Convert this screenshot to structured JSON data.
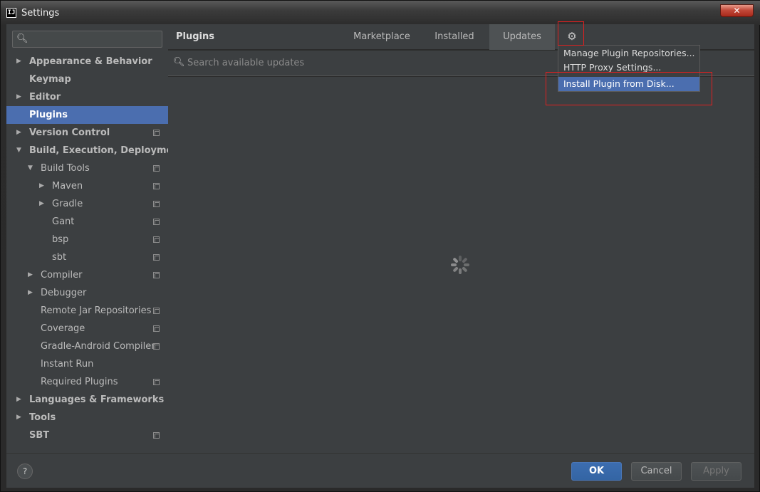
{
  "window": {
    "title": "Settings",
    "app_icon_text": "IJ",
    "close_glyph": "✕"
  },
  "sidebar": {
    "search_icon": "search-icon",
    "items": [
      {
        "label": "Appearance & Behavior",
        "level": 0,
        "arrow": "▶",
        "bold": true,
        "proj": false
      },
      {
        "label": "Keymap",
        "level": 0,
        "arrow": "",
        "bold": true,
        "proj": false
      },
      {
        "label": "Editor",
        "level": 0,
        "arrow": "▶",
        "bold": true,
        "proj": false
      },
      {
        "label": "Plugins",
        "level": 0,
        "arrow": "",
        "bold": true,
        "proj": false,
        "selected": true
      },
      {
        "label": "Version Control",
        "level": 0,
        "arrow": "▶",
        "bold": true,
        "proj": true
      },
      {
        "label": "Build, Execution, Deployment",
        "level": 0,
        "arrow": "▼",
        "bold": true,
        "proj": false
      },
      {
        "label": "Build Tools",
        "level": 1,
        "arrow": "▼",
        "bold": false,
        "proj": true
      },
      {
        "label": "Maven",
        "level": 2,
        "arrow": "▶",
        "bold": false,
        "proj": true
      },
      {
        "label": "Gradle",
        "level": 2,
        "arrow": "▶",
        "bold": false,
        "proj": true
      },
      {
        "label": "Gant",
        "level": 2,
        "arrow": "",
        "bold": false,
        "proj": true
      },
      {
        "label": "bsp",
        "level": 2,
        "arrow": "",
        "bold": false,
        "proj": true
      },
      {
        "label": "sbt",
        "level": 2,
        "arrow": "",
        "bold": false,
        "proj": true
      },
      {
        "label": "Compiler",
        "level": 1,
        "arrow": "▶",
        "bold": false,
        "proj": true
      },
      {
        "label": "Debugger",
        "level": 1,
        "arrow": "▶",
        "bold": false,
        "proj": false
      },
      {
        "label": "Remote Jar Repositories",
        "level": 1,
        "arrow": "",
        "bold": false,
        "proj": true
      },
      {
        "label": "Coverage",
        "level": 1,
        "arrow": "",
        "bold": false,
        "proj": true
      },
      {
        "label": "Gradle-Android Compiler",
        "level": 1,
        "arrow": "",
        "bold": false,
        "proj": true
      },
      {
        "label": "Instant Run",
        "level": 1,
        "arrow": "",
        "bold": false,
        "proj": false
      },
      {
        "label": "Required Plugins",
        "level": 1,
        "arrow": "",
        "bold": false,
        "proj": true
      },
      {
        "label": "Languages & Frameworks",
        "level": 0,
        "arrow": "▶",
        "bold": true,
        "proj": false
      },
      {
        "label": "Tools",
        "level": 0,
        "arrow": "▶",
        "bold": true,
        "proj": false
      },
      {
        "label": "SBT",
        "level": 0,
        "arrow": "",
        "bold": true,
        "proj": true
      }
    ]
  },
  "main": {
    "title": "Plugins",
    "tabs": [
      {
        "label": "Marketplace",
        "active": false
      },
      {
        "label": "Installed",
        "active": false
      },
      {
        "label": "Updates",
        "active": true
      }
    ],
    "gear_glyph": "⚙",
    "search_placeholder": "Search available updates"
  },
  "gear_menu": {
    "items": [
      {
        "label": "Manage Plugin Repositories...",
        "highlighted": false
      },
      {
        "label": "HTTP Proxy Settings...",
        "highlighted": false
      },
      {
        "label": "Install Plugin from Disk...",
        "highlighted": true
      }
    ]
  },
  "footer": {
    "help_label": "?",
    "ok_label": "OK",
    "cancel_label": "Cancel",
    "apply_label": "Apply"
  },
  "colors": {
    "selection": "#4b6eaf",
    "annotation_red": "#e02020",
    "background": "#3c3f41"
  }
}
